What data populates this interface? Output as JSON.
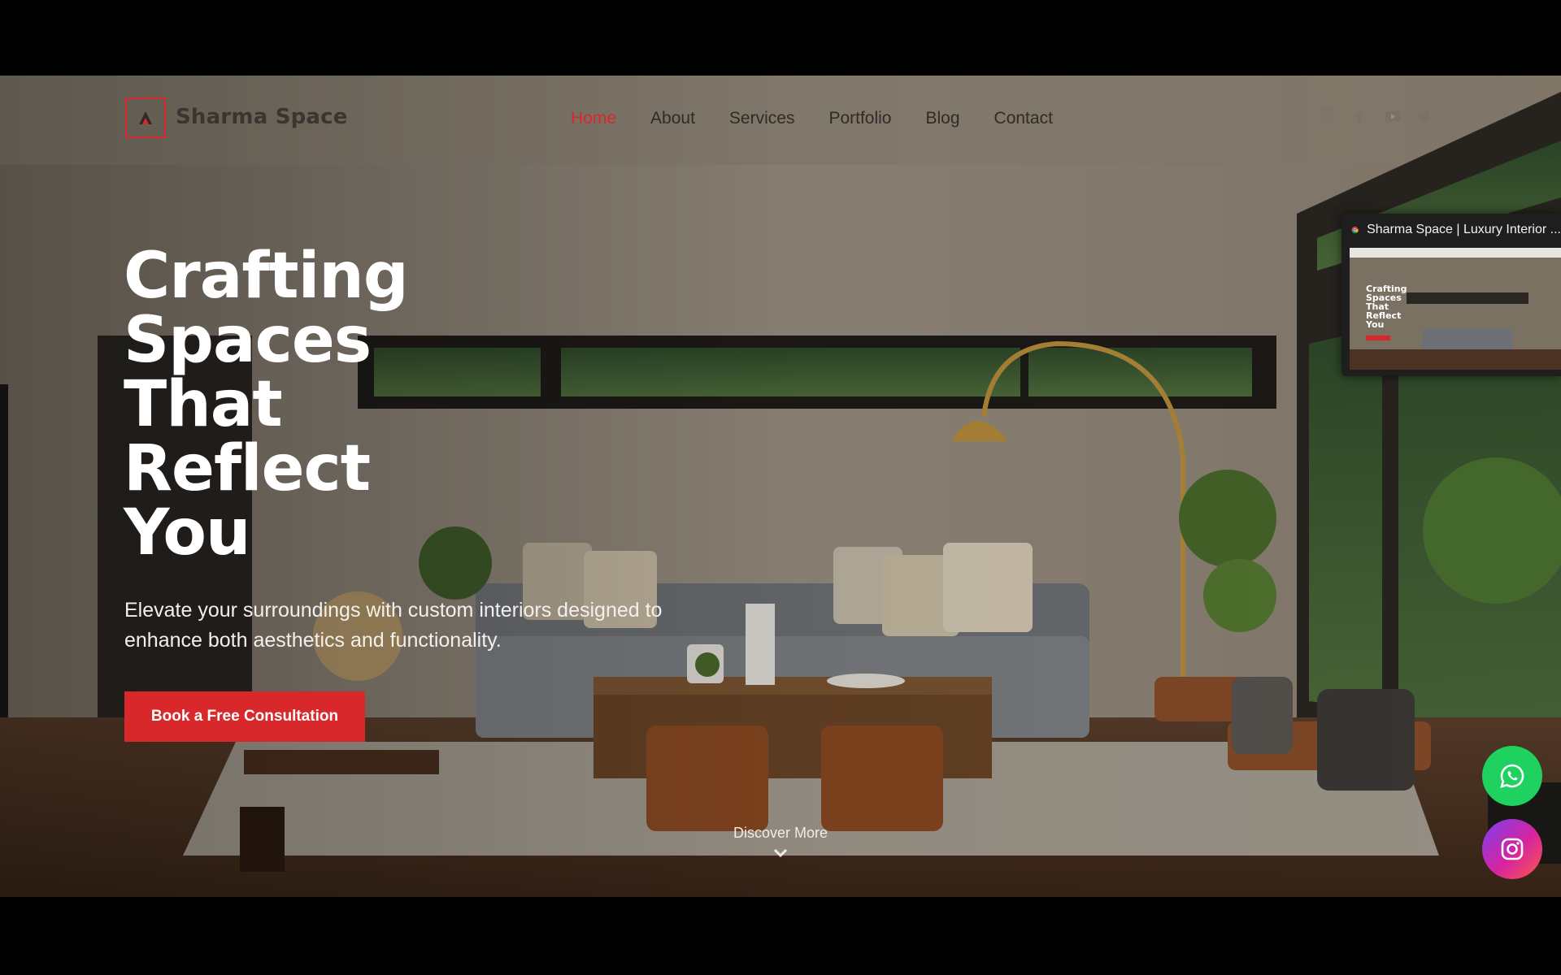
{
  "site": {
    "brand": "Sharma Space",
    "accent": "#d8282c"
  },
  "nav": {
    "items": [
      {
        "label": "Home",
        "active": true
      },
      {
        "label": "About",
        "active": false
      },
      {
        "label": "Services",
        "active": false
      },
      {
        "label": "Portfolio",
        "active": false
      },
      {
        "label": "Blog",
        "active": false
      },
      {
        "label": "Contact",
        "active": false
      }
    ],
    "socials": [
      "instagram-icon",
      "facebook-icon",
      "youtube-icon",
      "twitter-icon"
    ]
  },
  "hero": {
    "headline_lines": [
      "Crafting",
      "Spaces",
      "That",
      "Reflect",
      "You"
    ],
    "subtitle": "Elevate your surroundings with custom interiors designed to enhance both aesthetics and functionality.",
    "cta_label": "Book a Free Consultation",
    "discover_label": "Discover More"
  },
  "floating": {
    "whatsapp": {
      "icon": "whatsapp-icon",
      "color": "#1fd15e"
    },
    "instagram": {
      "icon": "instagram-icon"
    }
  },
  "pip_window": {
    "title": "Sharma Space | Luxury Interior ...",
    "thumb_headline": "Crafting Spaces That Reflect You"
  }
}
